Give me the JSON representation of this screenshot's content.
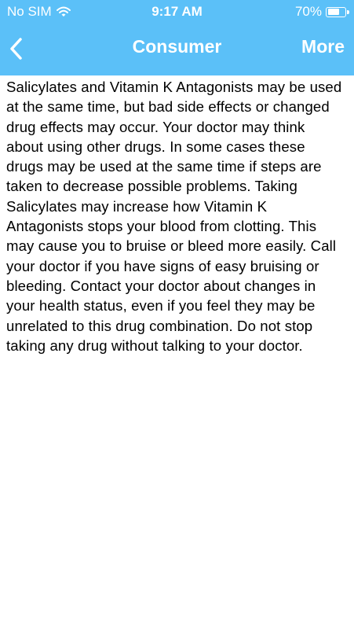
{
  "status": {
    "carrier": "No SIM",
    "time": "9:17 AM",
    "battery_text": "70%",
    "battery_level": 0.7
  },
  "nav": {
    "title": "Consumer",
    "more_label": "More"
  },
  "colors": {
    "header_bg": "#5bc0f8",
    "header_text": "#ffffff",
    "body_text": "#000000"
  },
  "content": {
    "text": "Salicylates and Vitamin K Antagonists may be used at the same time, but bad side effects or changed drug effects may occur. Your doctor may think about using other drugs. In some cases these drugs may be used at the same time if steps are taken to decrease possible problems. Taking Salicylates may increase how Vitamin K Antagonists stops your blood from clotting. This may cause you to bruise or bleed more easily. Call your doctor if you have signs of easy bruising or bleeding. Contact your doctor about changes in your health status, even if you feel they may be unrelated to this drug combination. Do not stop taking any drug without talking to your doctor."
  }
}
